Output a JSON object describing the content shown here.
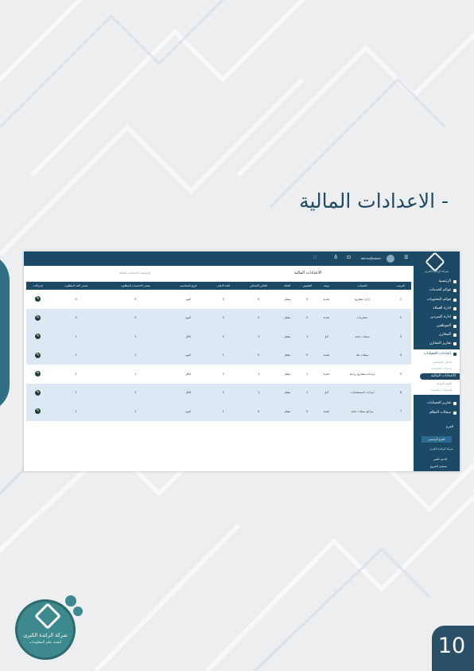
{
  "page": {
    "heading": "- الاعدادات المالية",
    "page_number": "10",
    "logo_name": "شركة الرائدة الكبرى",
    "logo_sub": "لتقنية نظم المعلومات"
  },
  "app": {
    "topbar": {
      "menu_icon": "menu-icon",
      "user": "admin@admin",
      "cart_icon": "cart-icon",
      "notify_icon": "bell-icon",
      "grid_icon": "grid-icon"
    },
    "sidebar": {
      "logo_text": "شركة الرائدة الكبرى",
      "items": [
        {
          "label": "الرئيسية",
          "icon": "home-icon"
        },
        {
          "label": "قوائم الخدمات",
          "icon": "list-icon"
        },
        {
          "label": "قوائم المحتويات",
          "icon": "list-icon"
        },
        {
          "label": "ادارة العملاء",
          "icon": "users-icon"
        },
        {
          "label": "ادارة المبردين",
          "icon": "settings-icon"
        },
        {
          "label": "الموظفين",
          "icon": "user-icon"
        },
        {
          "label": "المخازن",
          "icon": "warehouse-icon"
        },
        {
          "label": "تقارير المخازن",
          "icon": "report-icon"
        },
        {
          "label": "اعدادات الحسابات",
          "icon": "settings-icon"
        }
      ],
      "sub_items": [
        "الدليل المحاسبي",
        "اعدادات الحسابات"
      ],
      "active_item": "الاعدادات المالية",
      "after_active": [
        "القيود اليومية",
        "الحسابات الختامية"
      ],
      "bottom_items": [
        {
          "label": "تقارير الحسابات",
          "icon": "report-icon"
        },
        {
          "label": "سجلات النظام",
          "icon": "log-icon"
        }
      ],
      "branch_label": "الفرع",
      "branch_button": "الفرع الرئيسي",
      "company": "شركة الرائدة الكبرى",
      "footer_items": [
        "الدعم الفني",
        "تسجيل الخروج"
      ]
    },
    "main": {
      "title": "الاعدادات المالية",
      "breadcrumb": "الرئيسية / الاعدادات المالية",
      "columns": [
        "الترتيب",
        "الحساب",
        "نوعه",
        "الطبيعي",
        "الحالة",
        "الحالي الابتدائي",
        "الحد الاعلى",
        "تاريخ المحاسب",
        "مصدر الاحتساب المطلوب",
        "مصدر الحد المطلوب",
        "إجراءات"
      ],
      "rows": [
        {
          "n": "1",
          "name": "ادارة مشاريع",
          "type": "نقدية",
          "nat": "0",
          "status": "مفعل",
          "init": "0",
          "max": "0",
          "date": "اليوم",
          "src1": "0",
          "src2": "0"
        },
        {
          "n": "2",
          "name": "مشتريات",
          "type": "نقدية",
          "nat": "0",
          "status": "مفعل",
          "init": "0",
          "max": "0",
          "date": "اليوم",
          "src1": "0",
          "src2": "0"
        },
        {
          "n": "3",
          "name": "مبيعات عامة",
          "type": "أجل",
          "nat": "1",
          "status": "مفعل",
          "init": "1",
          "max": "2",
          "date": "الكل",
          "src1": "1",
          "src2": "1"
        },
        {
          "n": "4",
          "name": "مبيعات نقد",
          "type": "نقدية",
          "nat": "0",
          "status": "مفعل",
          "init": "0",
          "max": "1",
          "date": "اليوم",
          "src1": "1",
          "src2": "1"
        },
        {
          "n": "5",
          "name": "ايرادات مشاريع زراعة",
          "type": "نقدية",
          "nat": "1",
          "status": "مفعل",
          "init": "1",
          "max": "2",
          "date": "الكل",
          "src1": "1",
          "src2": "1"
        },
        {
          "n": "6",
          "name": "ايرادات المستشارات",
          "type": "أجل",
          "nat": "1",
          "status": "مفعل",
          "init": "1",
          "max": "2",
          "date": "الكل",
          "src1": "1",
          "src2": "1"
        },
        {
          "n": "7",
          "name": "مراجع مبيعات عامة",
          "type": "نقدية",
          "nat": "0",
          "status": "مفعل",
          "init": "0",
          "max": "1",
          "date": "اليوم",
          "src1": "1",
          "src2": "1"
        }
      ]
    }
  }
}
